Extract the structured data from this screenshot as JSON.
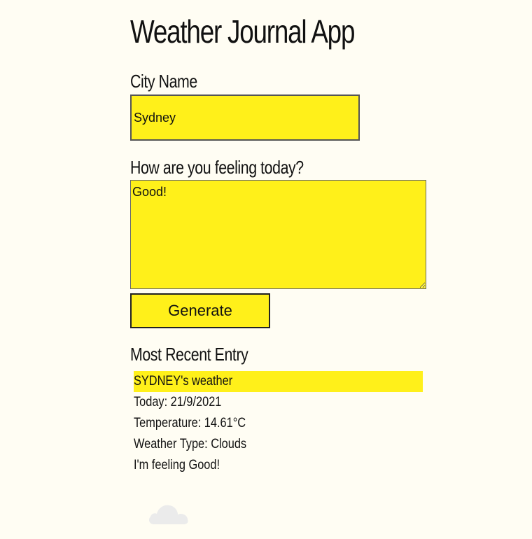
{
  "app": {
    "title": "Weather Journal App"
  },
  "form": {
    "city_label": "City Name",
    "city_value": "Sydney",
    "feeling_label": "How are you feeling today?",
    "feeling_value": "Good!",
    "generate_label": "Generate"
  },
  "recent": {
    "heading": "Most Recent Entry",
    "city_line": "SYDNEY's weather",
    "date_line": "Today: 21/9/2021",
    "temp_line": "Temperature: 14.61°C",
    "type_line": "Weather Type: Clouds",
    "feeling_line": "I'm feeling Good!"
  },
  "icons": {
    "weather_icon": "cloud-icon"
  },
  "colors": {
    "accent": "#fff01a",
    "background": "#fffdf3"
  }
}
